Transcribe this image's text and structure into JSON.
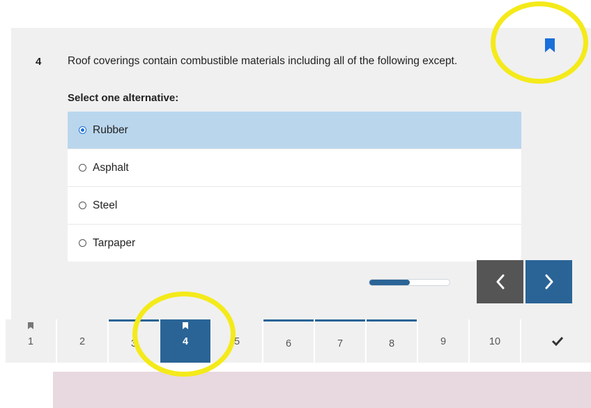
{
  "question": {
    "number": "4",
    "text": "Roof coverings contain combustible materials including all of the following except.",
    "instruction": "Select one alternative:"
  },
  "options": [
    {
      "label": "Rubber",
      "selected": true
    },
    {
      "label": "Asphalt",
      "selected": false
    },
    {
      "label": "Steel",
      "selected": false
    },
    {
      "label": "Tarpaper",
      "selected": false
    }
  ],
  "progress": {
    "fraction": 0.5
  },
  "navigation": {
    "prev_icon": "chevron-left-icon",
    "next_icon": "chevron-right-icon"
  },
  "tabs": [
    {
      "label": "1",
      "bookmarked": true,
      "answered": false,
      "active": false
    },
    {
      "label": "2",
      "bookmarked": false,
      "answered": false,
      "active": false
    },
    {
      "label": "3",
      "bookmarked": false,
      "answered": true,
      "active": false
    },
    {
      "label": "4",
      "bookmarked": true,
      "answered": true,
      "active": true
    },
    {
      "label": "5",
      "bookmarked": false,
      "answered": false,
      "active": false
    },
    {
      "label": "6",
      "bookmarked": false,
      "answered": true,
      "active": false
    },
    {
      "label": "7",
      "bookmarked": false,
      "answered": true,
      "active": false
    },
    {
      "label": "8",
      "bookmarked": false,
      "answered": true,
      "active": false
    },
    {
      "label": "9",
      "bookmarked": false,
      "answered": false,
      "active": false
    },
    {
      "label": "10",
      "bookmarked": false,
      "answered": false,
      "active": false
    }
  ],
  "finish_icon": "checkmark-icon",
  "colors": {
    "accent": "#2a6496",
    "selected_option": "#bad6ed",
    "bookmark": "#1a6fd8",
    "highlight": "#f4ea1a"
  }
}
